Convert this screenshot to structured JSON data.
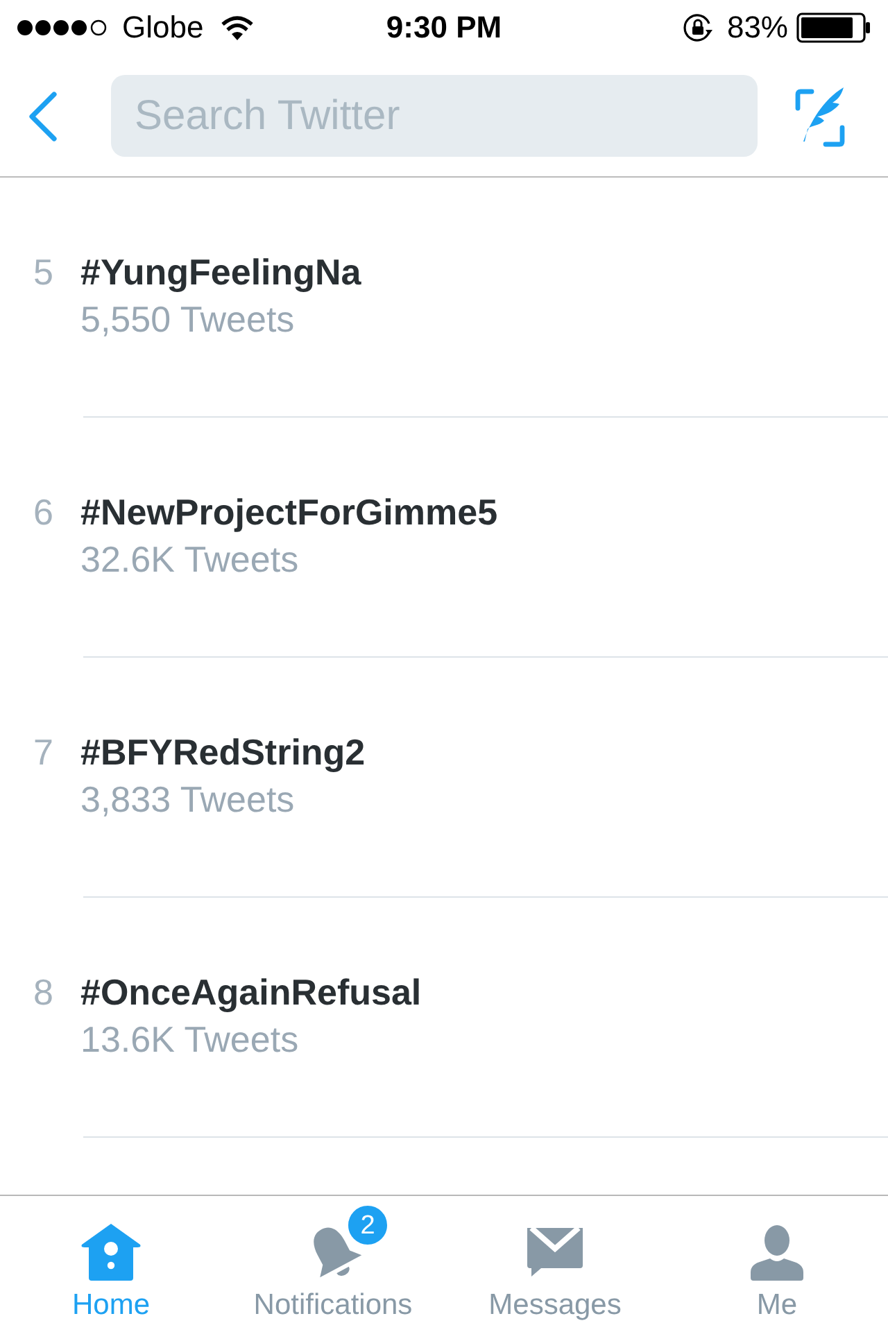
{
  "status_bar": {
    "carrier": "Globe",
    "time": "9:30 PM",
    "battery": "83%"
  },
  "nav_bar": {
    "search": {
      "placeholder": "Search Twitter"
    }
  },
  "trends": [
    {
      "rank": "5",
      "hashtag": "#YungFeelingNa",
      "count": "5,550 Tweets"
    },
    {
      "rank": "6",
      "hashtag": "#NewProjectForGimme5",
      "count": "32.6K Tweets"
    },
    {
      "rank": "7",
      "hashtag": "#BFYRedString2",
      "count": "3,833 Tweets"
    },
    {
      "rank": "8",
      "hashtag": "#OnceAgainRefusal",
      "count": "13.6K Tweets"
    }
  ],
  "tab_bar": [
    {
      "kind": "home",
      "label": "Home",
      "selected": true
    },
    {
      "kind": "notifications",
      "label": "Notifications",
      "selected": false,
      "badge": "2"
    },
    {
      "kind": "messages",
      "label": "Messages",
      "selected": false
    },
    {
      "kind": "me",
      "label": "Me",
      "selected": false
    }
  ]
}
